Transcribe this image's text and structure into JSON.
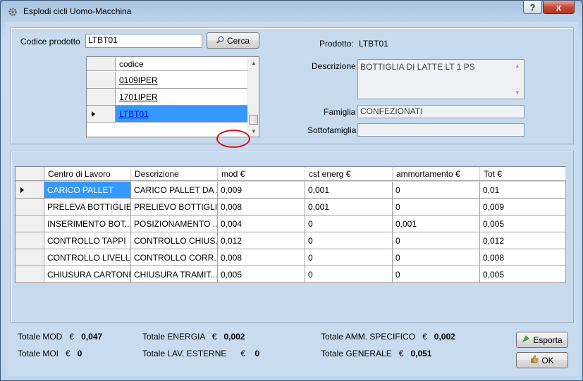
{
  "window": {
    "title": "Esplodi cicli Uomo-Macchina",
    "help_glyph": "?",
    "close_glyph": "x"
  },
  "search": {
    "label": "Codice prodotto",
    "value": "LTBT01",
    "button_label": "Cerca"
  },
  "dropdown": {
    "header": "codice",
    "rows": [
      "0109IPER",
      "1701IPER",
      "LTBT01"
    ],
    "selected_index": 2
  },
  "product": {
    "prodotto_label": "Prodotto:",
    "prodotto_value": "LTBT01",
    "descrizione_label": "Descrizione",
    "descrizione_value": "BOTTIGLIA DI LATTE LT 1 PS",
    "famiglia_label": "Famiglia",
    "famiglia_value": "CONFEZIONATI",
    "sottofamiglia_label": "Sottofamiglia",
    "sottofamiglia_value": ""
  },
  "grid": {
    "columns": [
      "Centro di Lavoro",
      "Descrizione",
      "mod €",
      "cst energ €",
      "ammortamento €",
      "Tot €"
    ],
    "rows": [
      [
        "CARICO PALLET",
        "CARICO PALLET DA ...",
        "0,009",
        "0,001",
        "0",
        "0,01"
      ],
      [
        "PRELEVA BOTTIGLIE",
        "PRELIEVO BOTTIGLIE",
        "0,008",
        "0,001",
        "0",
        "0,009"
      ],
      [
        "INSERIMENTO BOT...",
        "POSIZIONAMENTO ...",
        "0,004",
        "0",
        "0,001",
        "0,005"
      ],
      [
        "CONTROLLO TAPPI",
        "CONTROLLO CHIUS...",
        "0,012",
        "0",
        "0",
        "0,012"
      ],
      [
        "CONTROLLO LIVELL...",
        "CONTROLLO CORR...",
        "0,008",
        "0",
        "0",
        "0,008"
      ],
      [
        "CHIUSURA CARTONE",
        "CHIUSURA TRAMIT...",
        "0,005",
        "0",
        "0",
        "0,005"
      ]
    ],
    "current_row_index": 0,
    "annotation_color": "#d0161b"
  },
  "totals": {
    "currency": "€",
    "mod_label": "Totale MOD",
    "mod_value": "0,047",
    "moi_label": "Totale MOI",
    "moi_value": "0",
    "energia_label": "Totale ENERGIA",
    "energia_value": "0,002",
    "lav_esterne_label": "Totale LAV. ESTERNE",
    "lav_esterne_value": "0",
    "amm_label": "Totale AMM. SPECIFICO",
    "amm_value": "0,002",
    "generale_label": "Totale GENERALE",
    "generale_value": "0,051"
  },
  "actions": {
    "esporta_label": "Esporta",
    "ok_label": "OK"
  },
  "icons": {
    "app": "gear-icon",
    "search": "magnifier-icon",
    "esporta": "export-icon",
    "ok": "thumbs-up-icon"
  },
  "colors": {
    "selection": "#3399ff",
    "panel": "#c7daee"
  }
}
